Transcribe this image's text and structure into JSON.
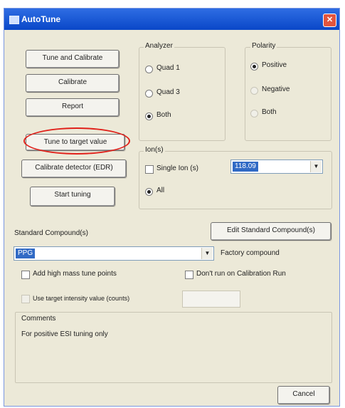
{
  "window": {
    "title": "AutoTune",
    "close_glyph": "✕"
  },
  "left_buttons": {
    "tune_calibrate": "Tune and Calibrate",
    "calibrate": "Calibrate",
    "report": "Report",
    "tune_target": "Tune to target value",
    "calibrate_detector": "Calibrate detector (EDR)",
    "start_tuning": "Start tuning"
  },
  "analyzer": {
    "label": "Analyzer",
    "options": [
      {
        "label": "Quad 1",
        "checked": false
      },
      {
        "label": "Quad 3",
        "checked": false
      },
      {
        "label": "Both",
        "checked": true
      }
    ]
  },
  "polarity": {
    "label": "Polarity",
    "options": [
      {
        "label": "Positive",
        "checked": true,
        "enabled": true
      },
      {
        "label": "Negative",
        "checked": false,
        "enabled": false
      },
      {
        "label": "Both",
        "checked": false,
        "enabled": false
      }
    ]
  },
  "ions": {
    "label": "Ion(s)",
    "single_label": "Single Ion (s)",
    "single_value": "118.09",
    "all_label": "All",
    "all_checked": true
  },
  "standard": {
    "label": "Standard Compound(s)",
    "edit_button": "Edit Standard Compound(s)",
    "combo_value": "PPG",
    "factory_label": "Factory compound",
    "add_high_mass": "Add high mass tune points",
    "dont_run_cal": "Don't run on Calibration Run",
    "use_target_label": "Use target intensity value (counts)"
  },
  "comments": {
    "label": "Comments",
    "text": "For positive ESI tuning only"
  },
  "cancel_button": "Cancel",
  "colors": {
    "accent": "#e0201a",
    "titlebar": "#0a47c8",
    "selection": "#316ac5"
  }
}
